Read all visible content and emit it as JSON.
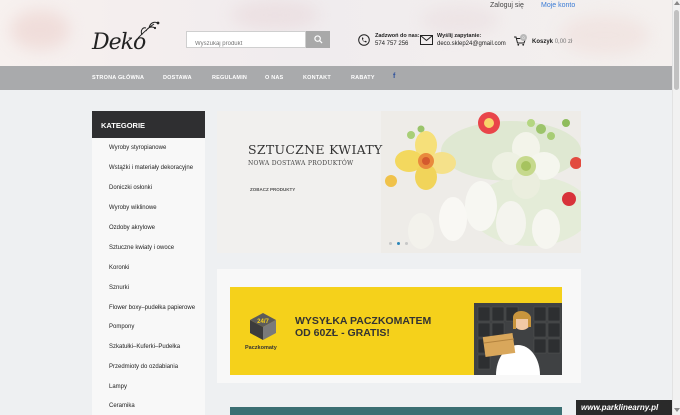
{
  "topbar": {
    "login": "Zaloguj się",
    "account": "Moje konto"
  },
  "logo": {
    "text": "Deko"
  },
  "search": {
    "placeholder": "Wyszukaj produkt"
  },
  "contact": {
    "phone_title": "Zadzwoń do nas:",
    "phone": "574 757 256",
    "mail_title": "Wyślij zapytanie:",
    "email": "deco.sklep24@gmail.com"
  },
  "cart": {
    "label": "Koszyk",
    "amount": "0,00 zł",
    "count": "0"
  },
  "nav": {
    "items": [
      "STRONA GŁÓWNA",
      "DOSTAWA",
      "REGULAMIN",
      "O NAS",
      "KONTAKT",
      "RABATY"
    ],
    "facebook": "f"
  },
  "sidebar": {
    "title": "KATEGORIE",
    "items": [
      "Wyroby styropianowe",
      "Wstążki i materiały dekoracyjne",
      "Doniczki osłonki",
      "Wyroby wiklinowe",
      "Ozdoby akrylowe",
      "Sztuczne kwiaty i owoce",
      "Koronki",
      "Sznurki",
      "Flower boxy–pudełka papierowe",
      "Pompony",
      "Szkatułki–Kuferki–Pudełka",
      "Przedmioty do ozdabiania",
      "Lampy",
      "Ceramika"
    ]
  },
  "slider": {
    "title": "SZTUCZNE KWIATY",
    "subtitle": "NOWA DOSTAWA PRODUKTÓW",
    "link": "ZOBACZ PRODUKTY",
    "active_slide": 2,
    "slide_count": 3
  },
  "promo": {
    "line1": "WYSYŁKA PACZKOMATEM",
    "line2": "OD 60ZŁ - GRATIS!",
    "brand": "Paczkomaty"
  },
  "watermark": "www.parklinearny.pl",
  "colors": {
    "nav": "#a9aaac",
    "sidebar_head": "#2f2f31",
    "promo": "#f5d11b",
    "link": "#3a7bd5"
  }
}
